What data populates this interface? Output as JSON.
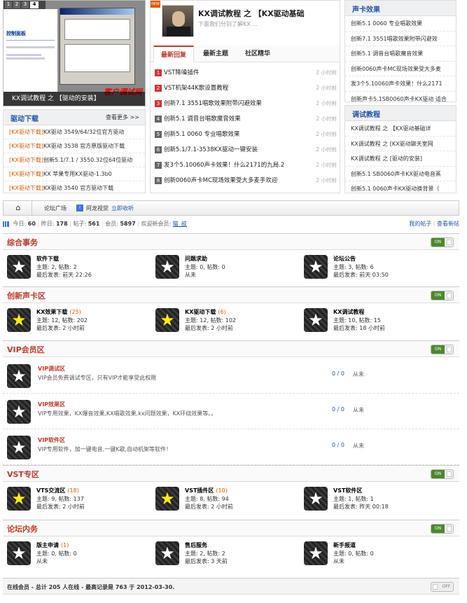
{
  "screenshot_tabs": [
    "1",
    "2",
    "3",
    "4"
  ],
  "hero_caption": "KX调试教程 之 【驱动的安装】",
  "hero_watermark": "客户调试网",
  "hero_panel_title": "控制面板",
  "driver": {
    "title": "驱动下载",
    "more": "查看更多 >>",
    "items": [
      {
        "tag": "[KX驱动下载]",
        "text": "KX驱动 3549/64/32位官方驱动"
      },
      {
        "tag": "[KX驱动下载]",
        "text": "KX驱动 3538 官方原版驱动下载"
      },
      {
        "tag": "[KX驱动下载]",
        "text": "创新5.1/7.1 / 3550.32位64位驱动"
      },
      {
        "tag": "[KX驱动下载]",
        "text": "KX 苹果专用KX驱动-1.3b0"
      },
      {
        "tag": "[KX驱动下载]",
        "text": "KX驱动 3540 官方驱动下载"
      }
    ]
  },
  "featured": {
    "badge": "NEW",
    "title": "KX调试教程 之 【KX驱动基础",
    "sub": "下面我们分别了解KX ..."
  },
  "tabs": [
    "最新回复",
    "最新主题",
    "社区精华"
  ],
  "latest": [
    {
      "n": "1",
      "c": "#d93030",
      "title": "VST降噪插件",
      "time": "2 小时前"
    },
    {
      "n": "2",
      "c": "#d93030",
      "title": "VST机架44K歌设置教程",
      "time": "2 小时前"
    },
    {
      "n": "3",
      "c": "#d93030",
      "title": "创新7.1 3551唱歌效果附带闪避效果",
      "time": "2 小时前"
    },
    {
      "n": "4",
      "c": "#666666",
      "title": "创新5.1 调音台唱歌魔音效果",
      "time": "2 小时前"
    },
    {
      "n": "5",
      "c": "#666666",
      "title": "创新5.1 0060 专业唱歌效果",
      "time": "2 小时前"
    },
    {
      "n": "6",
      "c": "#666666",
      "title": "创新5.1/7.1-3538KX驱动一键安装",
      "time": "2 小时前"
    },
    {
      "n": "7",
      "c": "#666666",
      "title": "发3个5.10060声卡效果！什么2171的九局.2",
      "time": "2 小时前"
    },
    {
      "n": "8",
      "c": "#666666",
      "title": "创新0060声卡MC现场效果受大多麦手欢迎",
      "time": "2 小时前"
    }
  ],
  "effects": {
    "title": "声卡效果",
    "items": [
      "创新5.1 0060 专业唱歌效果",
      "创新7.1 3551唱歌效果附带闪避效",
      "创新5.1 调音台唱歌魔音效果",
      "创新0060声卡MC现场效果受大多麦",
      "发3个5.10060声卡效果！什么2171",
      "创新声卡5.1SB0060声卡KX驱动 适合"
    ]
  },
  "tutorial": {
    "title": "调试教程",
    "items": [
      "KX调试教程 之 【KX驱动基础详",
      "KX调试教程 之 [KX驱动聊天室网",
      "KX调试教程 之 [驱动的安装]",
      "创新5.1 SB0060声卡KX驱动电音蒸",
      "创新5.1 0060声卡KX驱动换背景（"
    ]
  },
  "nav": {
    "forum": "论坛广场",
    "user": "阿龙视觉",
    "collect": "立即收听"
  },
  "stats": {
    "today_l": "今日:",
    "today": "60",
    "yest_l": "昨日:",
    "yest": "178",
    "posts_l": "帖子:",
    "posts": "561",
    "members_l": "会员:",
    "members": "5897",
    "welcome": "欢迎新会员:",
    "newuser": "猫_叔",
    "mine": "我的帖子",
    "newest": "查看新帖"
  },
  "sections": [
    {
      "title": "综合事务",
      "toggle": "ON",
      "forums": [
        {
          "name": "软件下载",
          "count": "",
          "stats": "主题: 2, 帖数: 2",
          "last": "最后发表: 前天 22:26",
          "new": false
        },
        {
          "name": "问题求助",
          "count": "",
          "stats": "主题: 0, 帖数: 0",
          "last": "从未",
          "new": false
        },
        {
          "name": "论坛公告",
          "count": "",
          "stats": "主题: 3, 帖数: 6",
          "last": "最后发表: 前天 03:50",
          "new": false
        }
      ]
    },
    {
      "title": "创新声卡区",
      "toggle": "ON",
      "forums": [
        {
          "name": "KX效果下载",
          "count": "(25)",
          "stats": "主题: 12, 帖数: 202",
          "last": "最后发表: 2 小时前",
          "new": true
        },
        {
          "name": "KX驱动下载",
          "count": "(6)",
          "stats": "主题: 12, 帖数: 102",
          "last": "最后发表: 2 小时前",
          "new": true
        },
        {
          "name": "KX调试教程",
          "count": "",
          "stats": "主题: 10, 帖数: 15",
          "last": "最后发表: 18 小时前",
          "new": false
        }
      ]
    },
    {
      "title": "VST专区",
      "toggle": "ON",
      "forums": [
        {
          "name": "VTS交流区",
          "count": "(18)",
          "stats": "主题: 9, 帖数: 137",
          "last": "最后发表: 2 小时前",
          "new": true
        },
        {
          "name": "VST插件区",
          "count": "(10)",
          "stats": "主题: 8, 帖数: 94",
          "last": "最后发表: 2 小时前",
          "new": true
        },
        {
          "name": "VST软件区",
          "count": "",
          "stats": "主题: 1, 帖数: 1",
          "last": "最后发表: 昨天 00:18",
          "new": false
        }
      ]
    },
    {
      "title": "论坛内务",
      "toggle": "ON",
      "forums": [
        {
          "name": "版主申请",
          "count": "(1)",
          "stats": "主题: 0, 帖数: 0",
          "last": "从未",
          "new": false
        },
        {
          "name": "售后服务",
          "count": "",
          "stats": "主题: 2, 帖数: 2",
          "last": "最后发表: 3 天前",
          "new": false
        },
        {
          "name": "新手报道",
          "count": "",
          "stats": "主题: 0, 帖数: 0",
          "last": "从未",
          "new": false
        }
      ]
    }
  ],
  "vip": {
    "title": "VIP会员区",
    "toggle": "ON",
    "forums": [
      {
        "name": "VIP调试区",
        "desc": "VIP会员免费调试专区，只有VIP才能享受此权限",
        "count": "0 / 0",
        "last": "从未"
      },
      {
        "name": "VIP效果区",
        "desc": "VIP专用效果，KX爆音效果,KX唱歌效果,kx问题效果，KX环绕效果等。。",
        "count": "0 / 0",
        "last": "从未"
      },
      {
        "name": "VIP软件区",
        "desc": "VIP专用软件，加一键电音,一键K歌,自动机架等软件！",
        "count": "0 / 0",
        "last": "从未"
      }
    ]
  },
  "online": {
    "text": "在线会员 - 总计 205 人在线 - 最高记录是 763 于 2012-03-30.",
    "toggle": "OFF"
  }
}
